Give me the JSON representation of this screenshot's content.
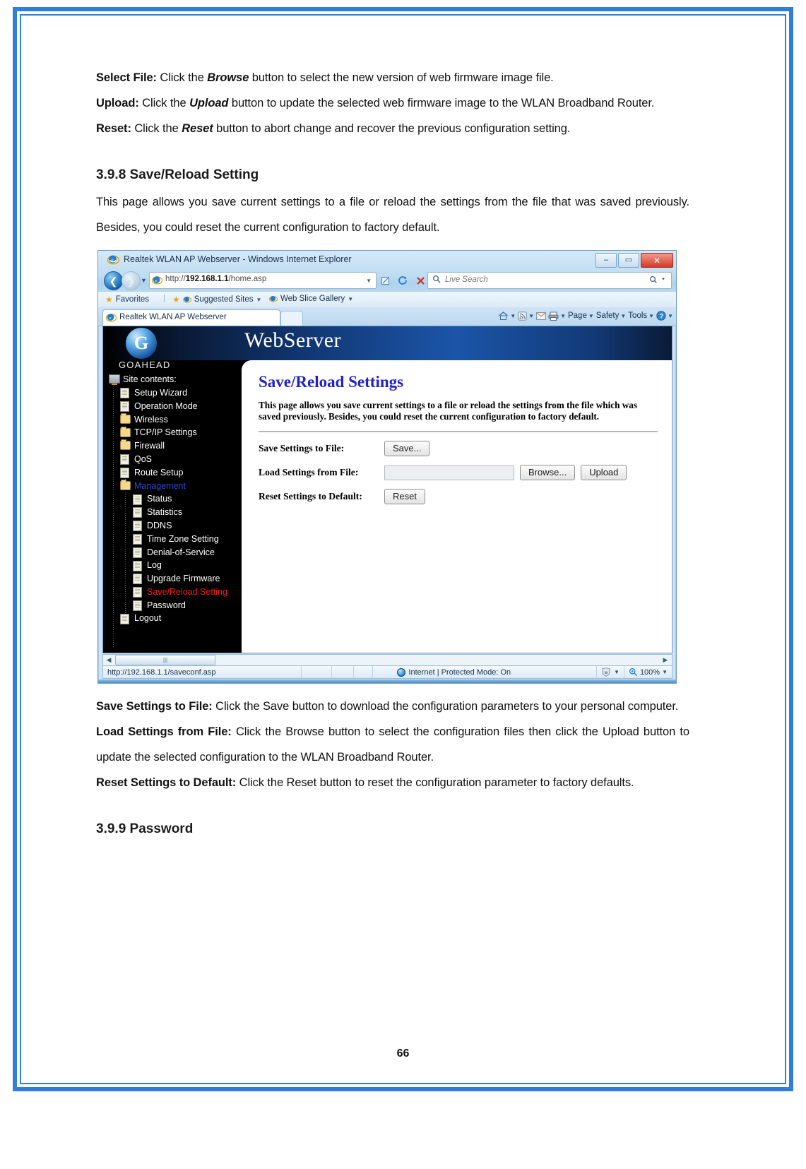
{
  "document": {
    "paragraphs": [
      {
        "id": "select-file",
        "term": "Select File:",
        "segments": [
          {
            "text": " Click the ",
            "style": "normal"
          },
          {
            "text": "Browse",
            "style": "bolditalic"
          },
          {
            "text": " button to select the new version of web firmware image file.",
            "style": "normal"
          }
        ]
      },
      {
        "id": "upload",
        "term": "Upload:",
        "segments": [
          {
            "text": " Click the ",
            "style": "normal"
          },
          {
            "text": "Upload",
            "style": "bolditalic"
          },
          {
            "text": " button to update the selected web firmware image to the WLAN Broadband Router.",
            "style": "normal"
          }
        ]
      },
      {
        "id": "reset",
        "term": "Reset:",
        "segments": [
          {
            "text": " Click the ",
            "style": "normal"
          },
          {
            "text": "Reset",
            "style": "bolditalic"
          },
          {
            "text": " button to abort change and recover the previous configuration setting.",
            "style": "normal"
          }
        ]
      }
    ],
    "section_heading": "3.9.8 Save/Reload Setting",
    "section_intro": "This page allows you save current settings to a file or reload the settings from the file that was saved previously. Besides, you could reset the current configuration to factory default.",
    "after_paragraphs": [
      {
        "id": "save-settings-to-file",
        "term": "Save Settings to File:",
        "body": " Click the Save button to download the configuration parameters to your personal computer."
      },
      {
        "id": "load-settings-from-file",
        "term": "Load Settings from File:",
        "body": " Click the Browse button to select the configuration files then click the Upload button to update the selected configuration to the WLAN Broadband Router."
      },
      {
        "id": "reset-settings-to-default",
        "term": "Reset Settings to Default:",
        "body": " Click the Reset button to reset the configuration parameter to factory defaults."
      }
    ],
    "next_heading": "3.9.9 Password",
    "page_number": "66"
  },
  "browser": {
    "window_title": "Realtek WLAN AP Webserver - Windows Internet Explorer",
    "window_buttons": {
      "minimize": "–",
      "maximize": "▭",
      "close": "✕"
    },
    "address": {
      "scheme": "http://",
      "host": "192.168.1.1",
      "path": "/home.asp",
      "dropdown_caret": "▼"
    },
    "address_icons": [
      "compatibility-view-icon",
      "refresh-icon",
      "stop-icon"
    ],
    "search": {
      "placeholder": "Live Search",
      "magnifier": "⌕",
      "caret": "▼"
    },
    "favorites_bar": {
      "favorites_label": "Favorites",
      "suggested_sites": "Suggested Sites",
      "web_slice_gallery": "Web Slice Gallery"
    },
    "tab_label": "Realtek WLAN AP Webserver",
    "command_bar": [
      "Page",
      "Safety",
      "Tools"
    ],
    "statusbar": {
      "url": "http://192.168.1.1/saveconf.asp",
      "zone": "Internet | Protected Mode: On",
      "zoom": "100%",
      "zoom_caret": "▼"
    }
  },
  "webpage": {
    "banner_title": "WebServer",
    "logo_letter": "G",
    "logo_word": "GOAHEAD",
    "tree_root": "Site contents:",
    "tree": [
      {
        "label": "Setup Wizard",
        "icon": "page-icon",
        "level": 1,
        "color": "normal"
      },
      {
        "label": "Operation Mode",
        "icon": "page-icon",
        "level": 1,
        "color": "normal"
      },
      {
        "label": "Wireless",
        "icon": "folder-icon",
        "level": 1,
        "color": "normal"
      },
      {
        "label": "TCP/IP Settings",
        "icon": "folder-icon",
        "level": 1,
        "color": "normal"
      },
      {
        "label": "Firewall",
        "icon": "folder-icon",
        "level": 1,
        "color": "normal"
      },
      {
        "label": "QoS",
        "icon": "page-icon",
        "level": 1,
        "color": "normal"
      },
      {
        "label": "Route Setup",
        "icon": "page-icon",
        "level": 1,
        "color": "normal"
      },
      {
        "label": "Management",
        "icon": "folder-icon",
        "level": 1,
        "color": "blue"
      },
      {
        "label": "Status",
        "icon": "page-icon",
        "level": 2,
        "color": "normal"
      },
      {
        "label": "Statistics",
        "icon": "page-icon",
        "level": 2,
        "color": "normal"
      },
      {
        "label": "DDNS",
        "icon": "page-icon",
        "level": 2,
        "color": "normal"
      },
      {
        "label": "Time Zone Setting",
        "icon": "page-icon",
        "level": 2,
        "color": "normal"
      },
      {
        "label": "Denial-of-Service",
        "icon": "page-icon",
        "level": 2,
        "color": "normal"
      },
      {
        "label": "Log",
        "icon": "page-icon",
        "level": 2,
        "color": "normal"
      },
      {
        "label": "Upgrade Firmware",
        "icon": "page-icon",
        "level": 2,
        "color": "normal"
      },
      {
        "label": "Save/Reload Setting",
        "icon": "page-icon",
        "level": 2,
        "color": "red"
      },
      {
        "label": "Password",
        "icon": "page-icon",
        "level": 2,
        "color": "normal"
      },
      {
        "label": "Logout",
        "icon": "page-icon",
        "level": 1,
        "color": "normal"
      }
    ],
    "panel": {
      "title": "Save/Reload Settings",
      "description": "This page allows you save current settings to a file or reload the settings from the file which was saved previously. Besides, you could reset the current configuration to factory default.",
      "rows": [
        {
          "label": "Save Settings to File:",
          "control": "button",
          "button": "Save..."
        },
        {
          "label": "Load Settings from File:",
          "control": "file",
          "input_value": "",
          "button1": "Browse...",
          "button2": "Upload"
        },
        {
          "label": "Reset Settings to Default:",
          "control": "button",
          "button": "Reset"
        }
      ]
    }
  },
  "colors": {
    "frame_blue": "#2f7fd6",
    "heading_blue": "#2222cc",
    "tree_blue": "#2b48e0",
    "tree_red": "#ff1a1a",
    "banner_blue": "#1b55a8"
  }
}
